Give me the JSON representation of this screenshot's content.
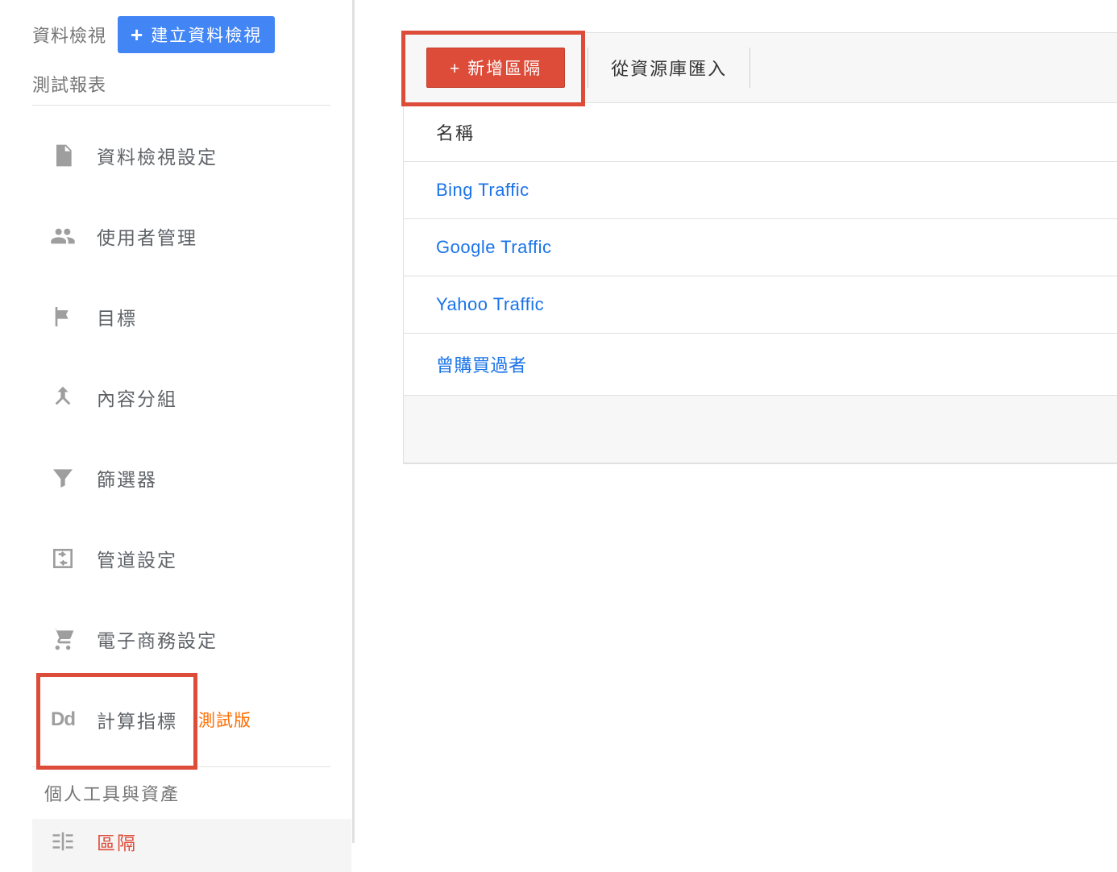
{
  "sidebar": {
    "header_label": "資料檢視",
    "create_button": "建立資料檢視",
    "subtitle": "測試報表",
    "nav": [
      {
        "label": "資料檢視設定"
      },
      {
        "label": "使用者管理"
      },
      {
        "label": "目標"
      },
      {
        "label": "內容分組"
      },
      {
        "label": "篩選器"
      },
      {
        "label": "管道設定"
      },
      {
        "label": "電子商務設定"
      },
      {
        "label": "計算指標",
        "badge": "測試版"
      }
    ],
    "section_title": "個人工具與資產",
    "segments_label": "區隔"
  },
  "toolbar": {
    "add_segment": "+ 新增區隔",
    "import_label": "從資源庫匯入"
  },
  "table": {
    "header": "名稱",
    "rows": [
      "Bing Traffic",
      "Google Traffic",
      "Yahoo Traffic",
      "曾購買過者"
    ]
  }
}
